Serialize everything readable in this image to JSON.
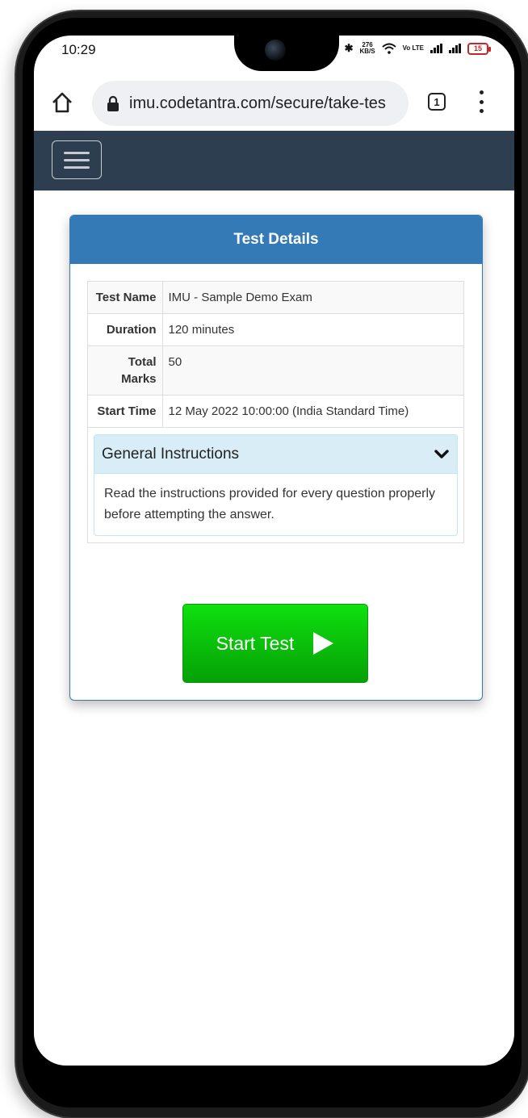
{
  "status_bar": {
    "time": "10:29",
    "net_speed_value": "276",
    "net_speed_unit": "KB/S",
    "volte": "Vo LTE",
    "battery": "15"
  },
  "browser": {
    "url": "imu.codetantra.com/secure/take-tes",
    "tab_count": "1"
  },
  "card": {
    "title": "Test Details",
    "rows": [
      {
        "label": "Test Name",
        "value": "IMU - Sample Demo Exam"
      },
      {
        "label": "Duration",
        "value": "120 minutes"
      },
      {
        "label": "Total Marks",
        "value": "50"
      },
      {
        "label": "Start Time",
        "value": "12 May 2022 10:00:00 (India Standard Time)"
      }
    ],
    "instructions": {
      "title": "General Instructions",
      "body": "Read the instructions provided for every question properly before attempting the answer."
    },
    "start_label": "Start Test"
  },
  "colors": {
    "navbar": "#2c3e50",
    "card_header": "#337ab7",
    "start_button": "#0cc40c",
    "instructions_header": "#d9edf7"
  }
}
